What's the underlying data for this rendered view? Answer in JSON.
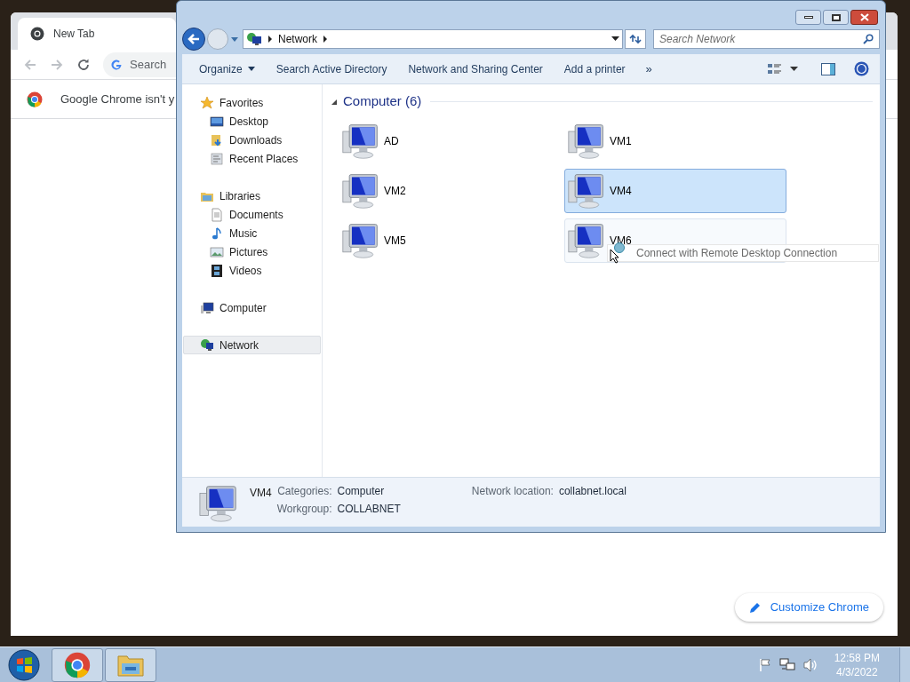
{
  "chrome": {
    "tab_title": "New Tab",
    "omnibox_placeholder": "Search",
    "infobar_text": "Google Chrome isn't y",
    "customize_button": "Customize Chrome"
  },
  "explorer": {
    "breadcrumb": [
      "Network"
    ],
    "search_placeholder": "Search Network",
    "toolbar": [
      {
        "label": "Organize",
        "kind": "menu"
      },
      {
        "label": "Search Active Directory",
        "kind": "command"
      },
      {
        "label": "Network and Sharing Center",
        "kind": "command"
      },
      {
        "label": "Add a printer",
        "kind": "command"
      }
    ],
    "toolbar_overflow": "»",
    "nav": [
      {
        "label": "Favorites",
        "kind": "star",
        "selected": false,
        "children": [
          {
            "label": "Desktop",
            "kind": "desktop",
            "selected": false
          },
          {
            "label": "Downloads",
            "kind": "downloads",
            "selected": false
          },
          {
            "label": "Recent Places",
            "kind": "recent",
            "selected": false
          }
        ]
      },
      {
        "label": "Libraries",
        "kind": "libraries",
        "selected": false,
        "children": [
          {
            "label": "Documents",
            "kind": "documents",
            "selected": false
          },
          {
            "label": "Music",
            "kind": "music",
            "selected": false
          },
          {
            "label": "Pictures",
            "kind": "pictures",
            "selected": false
          },
          {
            "label": "Videos",
            "kind": "videos",
            "selected": false
          }
        ]
      },
      {
        "label": "Computer",
        "kind": "computer",
        "selected": false
      },
      {
        "label": "Network",
        "kind": "network",
        "selected": true
      }
    ],
    "group": {
      "title": "Computer (6)",
      "expanded": true
    },
    "items": [
      {
        "name": "AD",
        "selected": false,
        "hovered": false
      },
      {
        "name": "VM1",
        "selected": false,
        "hovered": false
      },
      {
        "name": "VM2",
        "selected": false,
        "hovered": false
      },
      {
        "name": "VM4",
        "selected": true,
        "hovered": false
      },
      {
        "name": "VM5",
        "selected": false,
        "hovered": false
      },
      {
        "name": "VM6",
        "selected": false,
        "hovered": true
      }
    ],
    "drag_tooltip": "Connect with Remote Desktop Connection",
    "details": {
      "name": "VM4",
      "columns": [
        [
          {
            "label": "Categories:",
            "value": "Computer"
          },
          {
            "label": "Workgroup:",
            "value": "COLLABNET"
          }
        ],
        [
          {
            "label": "Network location:",
            "value": "collabnet.local"
          }
        ]
      ]
    }
  },
  "taskbar": {
    "apps": [
      {
        "kind": "chrome"
      },
      {
        "kind": "explorer"
      }
    ],
    "time": "12:58 PM",
    "date": "4/3/2022"
  }
}
